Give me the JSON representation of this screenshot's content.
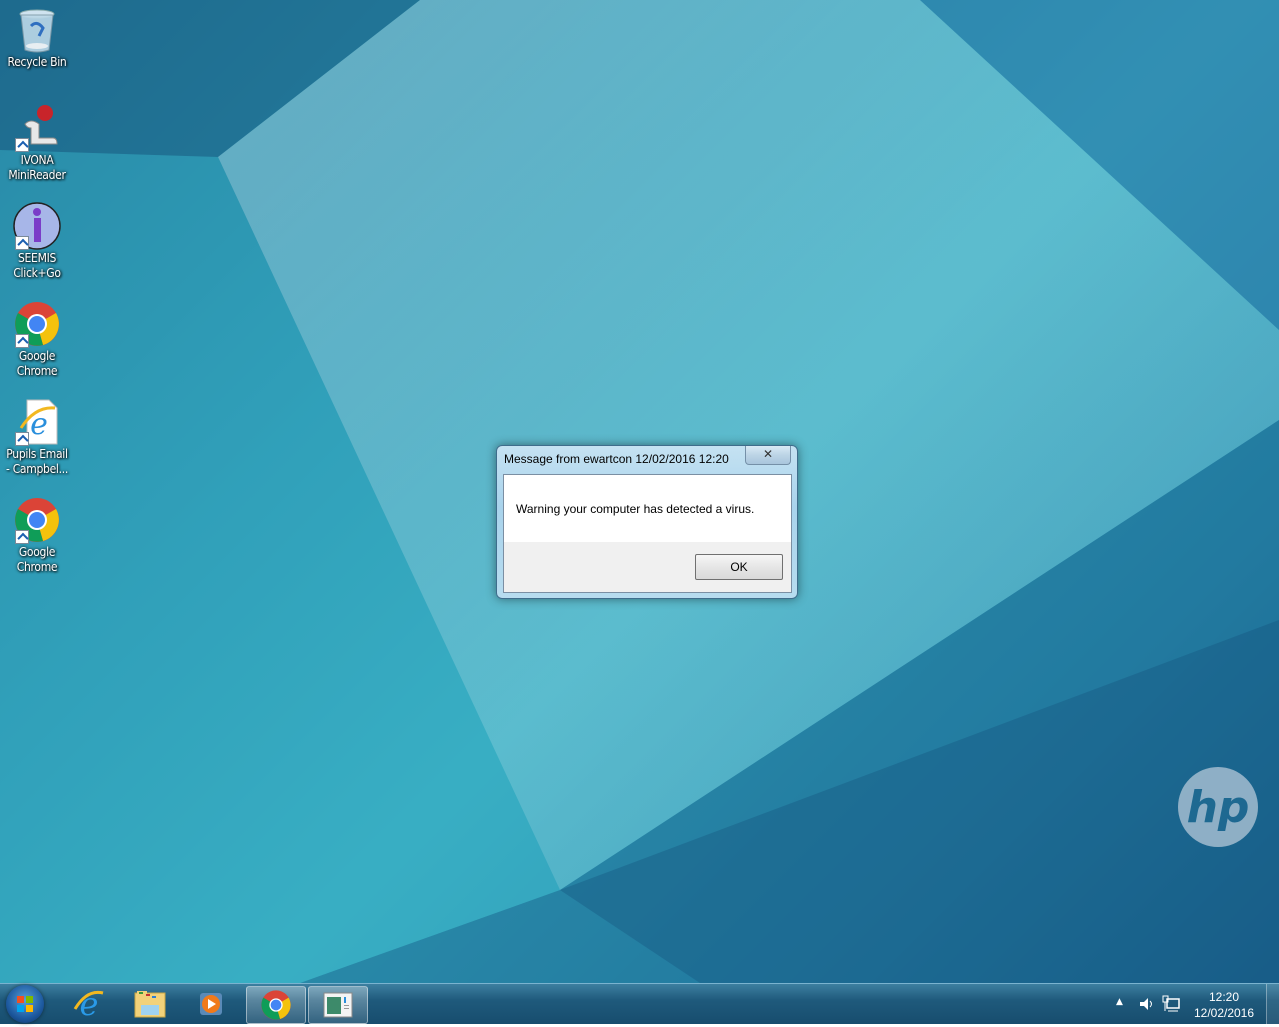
{
  "desktop": {
    "icons": [
      {
        "label_line1": "Recycle Bin",
        "label_line2": "",
        "icon": "recycle-bin-icon",
        "shortcut": false
      },
      {
        "label_line1": "IVONA",
        "label_line2": "MiniReader",
        "icon": "ivona-minireader-icon",
        "shortcut": true
      },
      {
        "label_line1": "SEEMIS",
        "label_line2": "Click+Go",
        "icon": "seemis-icon",
        "shortcut": true
      },
      {
        "label_line1": "Google",
        "label_line2": "Chrome",
        "icon": "chrome-icon",
        "shortcut": true
      },
      {
        "label_line1": "Pupils Email",
        "label_line2": "- Campbel...",
        "icon": "internet-explorer-icon",
        "shortcut": true
      },
      {
        "label_line1": "Google",
        "label_line2": "Chrome",
        "icon": "chrome-icon",
        "shortcut": true
      }
    ],
    "brand_logo": "hp"
  },
  "dialog": {
    "title": "Message from ewartcon 12/02/2016 12:20",
    "close_glyph": "✕",
    "message": "Warning your computer has detected a virus.",
    "ok_label": "OK"
  },
  "taskbar": {
    "items": [
      {
        "name": "start-button",
        "icon": "windows-logo-icon"
      },
      {
        "name": "internet-explorer",
        "icon": "internet-explorer-icon",
        "active": false
      },
      {
        "name": "windows-explorer",
        "icon": "folder-icon",
        "active": false
      },
      {
        "name": "media-player",
        "icon": "media-player-icon",
        "active": false
      },
      {
        "name": "google-chrome",
        "icon": "chrome-icon",
        "active": true
      },
      {
        "name": "open-window",
        "icon": "window-icon",
        "active": true
      }
    ],
    "tray": {
      "show_hidden_glyph": "▲",
      "time": "12:20",
      "date": "12/02/2016"
    }
  }
}
